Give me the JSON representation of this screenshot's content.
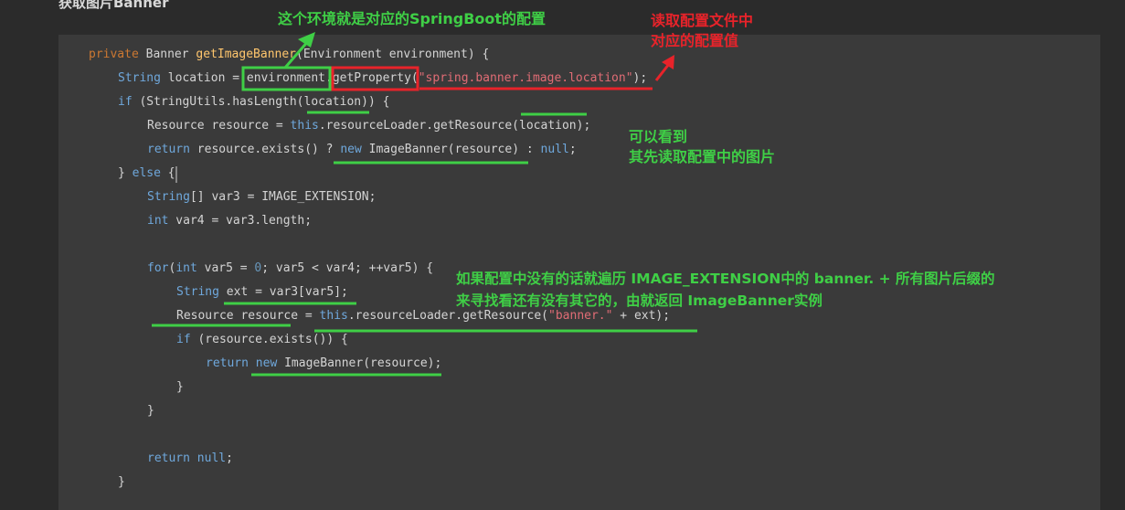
{
  "heading": "获取图片Banner",
  "code": {
    "l1": [
      "private",
      " Banner ",
      "getImageBanner",
      "(Environment environment) {"
    ],
    "l2": [
      "String",
      " location = ",
      "environment",
      ".",
      "getProperty",
      "(",
      "\"spring.banner.image.location\"",
      ");"
    ],
    "l3": [
      "if",
      " (StringUtils.hasLength(",
      "location",
      ")) {"
    ],
    "l4": [
      "Resource resource = ",
      "this",
      ".resourceLoader.getResource(",
      "location",
      ");"
    ],
    "l5": [
      "return",
      " resource.exists() ? ",
      "new",
      " ImageBanner(resource) : ",
      "null",
      ";"
    ],
    "l6": [
      "} ",
      "else",
      " {"
    ],
    "l7": [
      "String",
      "[] var3 = IMAGE_EXTENSION;"
    ],
    "l8": [
      "int",
      " var4 = var3.length;"
    ],
    "l9": [
      "for",
      "(",
      "int",
      " var5 = ",
      "0",
      "; var5 < var4; ++var5) {"
    ],
    "l10": [
      "String",
      " ext = var3[var5];"
    ],
    "l11": [
      "Resource resource = ",
      "this",
      ".resourceLoader.getResource(",
      "\"banner.\"",
      " + ext);"
    ],
    "l12": [
      "if",
      " (resource.exists()) {"
    ],
    "l13": [
      "return",
      " ",
      "new",
      " ImageBanner(resource);"
    ],
    "l14": "}",
    "l15": "}",
    "l16": [
      "return",
      " ",
      "null",
      ";"
    ],
    "l17": "}"
  },
  "annotations": {
    "env_config": "这个环境就是对应的SpringBoot的配置",
    "read_config": "读取配置文件中\n对应的配置值",
    "read_image": "可以看到\n其先读取配置中的图片",
    "traverse": "如果配置中没有的话就遍历 IMAGE_EXTENSION中的 banner. + 所有图片后缀的\n来寻找看还有没有其它的，由就返回 ImageBanner实例"
  },
  "colors": {
    "annotation_green": "#3fcf46",
    "annotation_red": "#e8232a",
    "code_bg": "#3a3a3a"
  }
}
